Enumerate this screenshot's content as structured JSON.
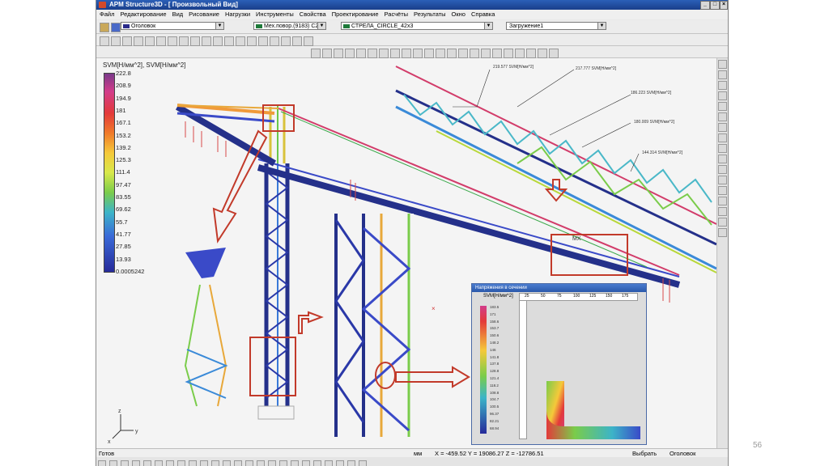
{
  "window": {
    "title": "APM Structure3D - [ Произвольный Вид]"
  },
  "menu": [
    "Файл",
    "Редактирование",
    "Вид",
    "Рисование",
    "Нагрузки",
    "Инструменты",
    "Свойства",
    "Проектирование",
    "Расчёты",
    "Результаты",
    "Окно",
    "Справка"
  ],
  "toolbar": {
    "layer_combo": "Оголовок",
    "material_combo": "Мех.повор.(9183) С2",
    "section_combo": "СТРЕЛА_CIRCLE_42x3",
    "load_combo": "Загружение1",
    "colors": {
      "layer": "#2a2a8a",
      "material": "#1f7a3a",
      "section": "#1f7a3a"
    }
  },
  "legend": {
    "title": "SVM[Н/мм^2], SVM[Н/мм^2]",
    "values": [
      "222.8",
      "208.9",
      "194.9",
      "181",
      "167.1",
      "153.2",
      "139.2",
      "125.3",
      "111.4",
      "97.47",
      "83.55",
      "69.62",
      "55.7",
      "41.77",
      "27.85",
      "13.93",
      "0.0005242"
    ]
  },
  "callouts": [
    "219.577 SVM[Н/мм^2]",
    "217.777 SVM[Н/мм^2]",
    "186.223 SVM[Н/мм^2]",
    "180.009 SVM[Н/мм^2]",
    "144.314 SVM[Н/мм^2]"
  ],
  "labels": {
    "mx": "MX"
  },
  "popup": {
    "title": "Напряжения в сечении",
    "label": "SVM[Н/мм^2]",
    "values": [
      "183.5",
      "171",
      "158.6",
      "153.7",
      "150.6",
      "148.2",
      "146",
      "141.8",
      "137.8",
      "128.8",
      "121.4",
      "118.2",
      "108.8",
      "104.7",
      "100.5",
      "96.37",
      "82.21",
      "68.94"
    ],
    "ruler": [
      "25",
      "50",
      "75",
      "100",
      "125",
      "150",
      "175"
    ]
  },
  "status": {
    "ready": "Готов",
    "units": "мм",
    "coords": "X = -459.52 Y = 19086.27 Z = -12786.51",
    "mode": "Выбрать",
    "layer": "Оголовок"
  },
  "page_number": "56"
}
